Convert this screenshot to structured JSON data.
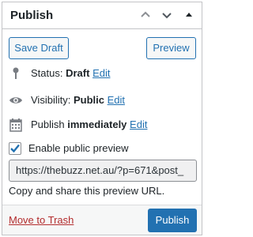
{
  "header": {
    "title": "Publish",
    "icons": [
      "chevron-up-icon",
      "chevron-down-icon",
      "caret-up-icon"
    ]
  },
  "actions": {
    "save_draft_label": "Save Draft",
    "preview_label": "Preview"
  },
  "status": {
    "label": "Status:",
    "value": "Draft",
    "edit_label": "Edit",
    "icon": "pin-icon"
  },
  "visibility": {
    "label": "Visibility:",
    "value": "Public",
    "edit_label": "Edit",
    "icon": "eye-icon"
  },
  "schedule": {
    "label": "Publish",
    "value": "immediately",
    "edit_label": "Edit",
    "icon": "calendar-icon"
  },
  "public_preview": {
    "checkbox_label": "Enable public preview",
    "checked": true,
    "url": "https://thebuzz.net.au/?p=671&post_",
    "hint": "Copy and share this preview URL."
  },
  "footer": {
    "trash_label": "Move to Trash",
    "publish_label": "Publish"
  },
  "colors": {
    "accent": "#2271b1",
    "danger": "#b32d2e",
    "border": "#c3c4c7"
  }
}
